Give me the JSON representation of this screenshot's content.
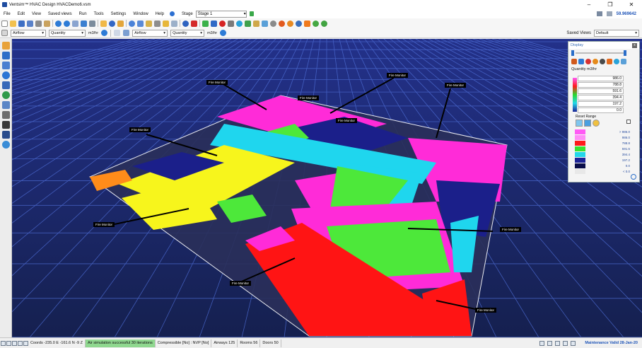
{
  "window": {
    "title": "Ventsim™ HVAC Design  HVACDemo6.vsm",
    "minimize": "–",
    "maximize": "❐",
    "close": "✕"
  },
  "menu": {
    "items": [
      "File",
      "Edit",
      "View",
      "Saved views",
      "Run",
      "Tools",
      "Settings",
      "Window",
      "Help"
    ],
    "stage_label": "Stage",
    "stage_value": "Stage 1",
    "balance": "59.969642"
  },
  "toolbar2": {
    "airflow_left": "Airflow",
    "quantity_left": "Quantity",
    "unit_left": "m3/hr",
    "airflow_right": "Airflow",
    "quantity_right": "Quantity",
    "unit_right": "m3/hr",
    "saved_views_label": "Saved Views",
    "saved_views_value": "Default"
  },
  "display_panel": {
    "title": "Display",
    "close": "x",
    "quantity_label": "Quantity m3/hr",
    "values": [
      "986.0",
      "788.8",
      "591.6",
      "394.4",
      "197.2",
      "0.0"
    ],
    "reset_range_label": "Reset Range",
    "legend": [
      {
        "color": "#ff5af5",
        "label": "> 986.0"
      },
      {
        "color": "#ff8cf7",
        "label": "986.0"
      },
      {
        "color": "#ff1b1b",
        "label": "788.8"
      },
      {
        "color": "#39e32f",
        "label": "591.6"
      },
      {
        "color": "#24d7ea",
        "label": "394.4"
      },
      {
        "color": "#1d2396",
        "label": "197.2"
      },
      {
        "color": "#0a0e4a",
        "label": "0.0"
      },
      {
        "color": "#e8e8e8",
        "label": "< 0.0"
      }
    ]
  },
  "viewport": {
    "fire_monitor_labels": [
      "Fire Monitor",
      "Fire Monitor",
      "Fire Monitor",
      "Fire Monitor",
      "Fire Monitor",
      "Fire Monitor",
      "Fire Monitor",
      "Fire Monitor",
      "Fire Monitor",
      "Fire Monitor"
    ]
  },
  "status": {
    "coords": "Coords -235.0 E   -161.6 N   -9 Z",
    "message": "Air simulation successful 30 iterations",
    "compressible": "Compressible [No] : NVP [No]",
    "airways": "Airways 125",
    "rooms": "Rooms 56",
    "doors": "Doors 50",
    "maintenance": "Maintenance Valid 28-Jan-20"
  },
  "colors": {
    "background": "#1e2a6e",
    "grid": "#4f6fd8",
    "magenta": "#ff2bd8",
    "red": "#ff1414",
    "green": "#4de83a",
    "cyan": "#1fd6ee",
    "navy": "#1b1f8a",
    "yellow": "#f7f51c",
    "orange": "#ff8c1a"
  }
}
